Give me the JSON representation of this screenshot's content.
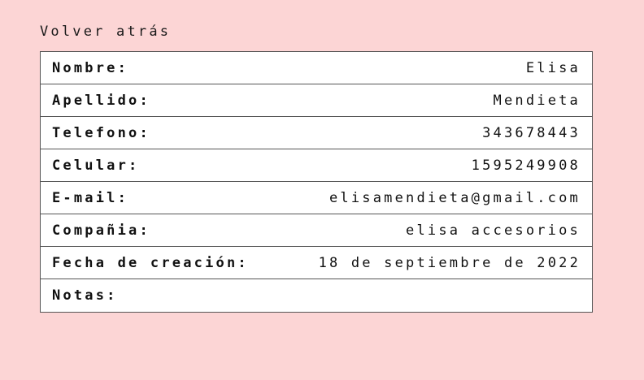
{
  "back": {
    "label": "Volver atrás"
  },
  "contact": {
    "rows": [
      {
        "label": "Nombre:",
        "value": "Elisa"
      },
      {
        "label": "Apellido:",
        "value": "Mendieta"
      },
      {
        "label": "Telefono:",
        "value": "343678443"
      },
      {
        "label": "Celular:",
        "value": "1595249908"
      },
      {
        "label": "E-mail:",
        "value": "elisamendieta@gmail.com"
      },
      {
        "label": "Compañia:",
        "value": "elisa accesorios"
      },
      {
        "label": "Fecha de creación:",
        "value": "18 de septiembre de 2022"
      },
      {
        "label": "Notas:",
        "value": ""
      }
    ]
  },
  "colors": {
    "background": "#fcd5d5",
    "table_background": "#ffffff",
    "border": "#555555",
    "text": "#111111"
  }
}
